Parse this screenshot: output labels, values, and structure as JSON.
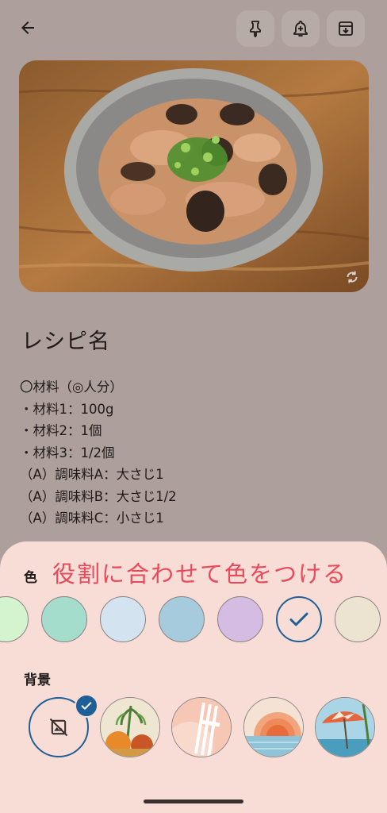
{
  "toolbar": {
    "back_icon": "arrow-left-icon",
    "actions": [
      {
        "name": "pin-button",
        "icon": "pin-icon"
      },
      {
        "name": "reminder-button",
        "icon": "bell-plus-icon"
      },
      {
        "name": "archive-button",
        "icon": "archive-icon"
      }
    ]
  },
  "note": {
    "title": "レシピ名",
    "lines": [
      "〇材料（◎人分）",
      "・材料1：100g",
      "・材料2：1個",
      "・材料3：1/2個",
      "（A）調味料A：大さじ1",
      "（A）調味料B：大さじ1/2",
      "（A）調味料C：小さじ1"
    ]
  },
  "sheet": {
    "color_label": "色",
    "annotation": "役割に合わせて色をつける",
    "background_label": "背景",
    "colors": [
      {
        "name": "green",
        "hex": "#d4f3cf",
        "selected": false
      },
      {
        "name": "teal",
        "hex": "#a5ddcd",
        "selected": false
      },
      {
        "name": "light-blue",
        "hex": "#d3e4f0",
        "selected": false
      },
      {
        "name": "blue",
        "hex": "#a5cbdc",
        "selected": false
      },
      {
        "name": "purple",
        "hex": "#d4bce3",
        "selected": false
      },
      {
        "name": "default",
        "hex": "#f8ddd7",
        "selected": true
      },
      {
        "name": "beige",
        "hex": "#ece3d0",
        "selected": false
      }
    ],
    "backgrounds": [
      {
        "name": "none",
        "selected": true
      },
      {
        "name": "groceries",
        "selected": false
      },
      {
        "name": "food",
        "selected": false
      },
      {
        "name": "sunset",
        "selected": false
      },
      {
        "name": "beach",
        "selected": false
      }
    ]
  },
  "colors": {
    "page_bg": "#ac9f9c",
    "sheet_bg": "#f8ddd7",
    "accent": "#1f5f97",
    "annotation": "#e84a5b"
  }
}
